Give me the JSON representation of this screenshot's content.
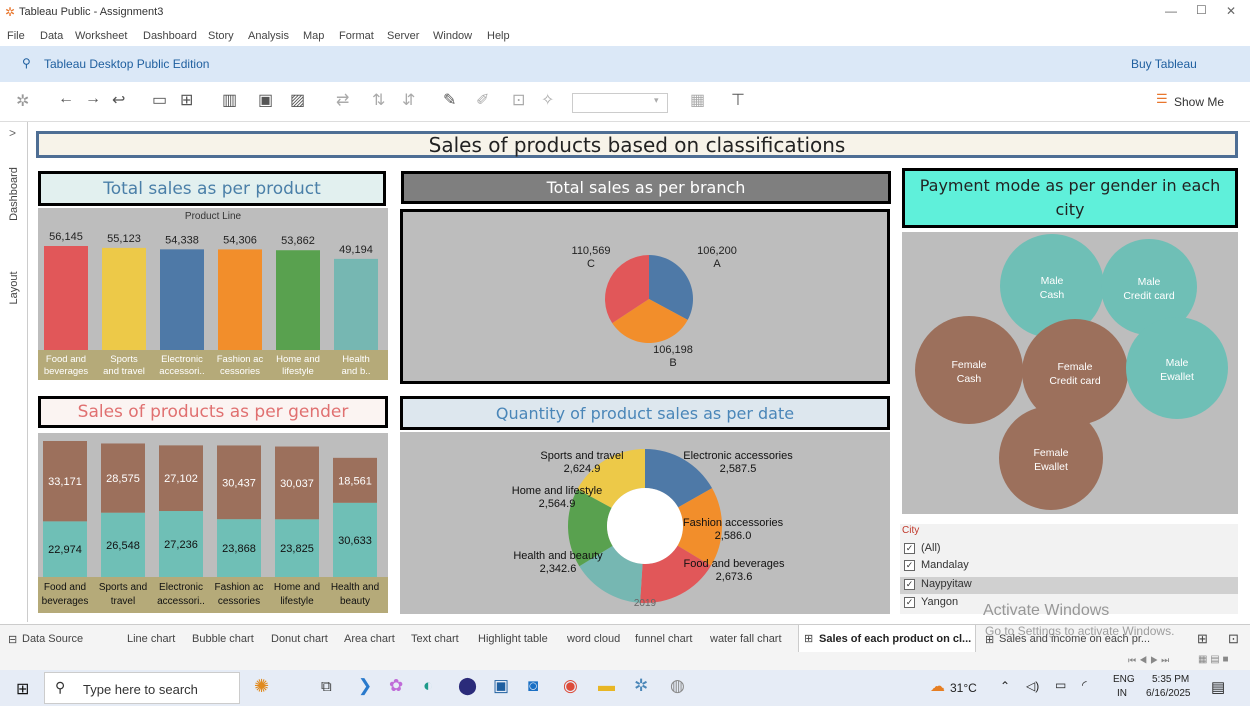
{
  "window": {
    "title": "Tableau Public - Assignment3",
    "controls": [
      "—",
      "☐",
      "✕"
    ]
  },
  "menu": [
    "File",
    "Data",
    "Worksheet",
    "Dashboard",
    "Story",
    "Analysis",
    "Map",
    "Format",
    "Server",
    "Window",
    "Help"
  ],
  "public_bar": {
    "edition": "Tableau Desktop Public Edition",
    "buy": "Buy Tableau"
  },
  "toolbar": {
    "show_me": "Show Me"
  },
  "side_tabs": {
    "expand": ">",
    "dashboard": "Dashboard",
    "layout": "Layout"
  },
  "dashboard_title": "Sales of products based on classifications",
  "product_sales": {
    "title": "Total sales as per product",
    "header": "Product Line",
    "categories": [
      "Food and beverages",
      "Sports and travel",
      "Electronic accessori..",
      "Fashion ac cessories",
      "Home and lifestyle",
      "Health and b.."
    ],
    "cat_lines": [
      [
        "Food and",
        "beverages"
      ],
      [
        "Sports",
        "and travel"
      ],
      [
        "Electronic",
        "accessori.."
      ],
      [
        "Fashion ac",
        "cessories"
      ],
      [
        "Home and",
        "lifestyle"
      ],
      [
        "Health",
        "and b.."
      ]
    ],
    "value_labels": [
      "56,145",
      "55,123",
      "54,338",
      "54,306",
      "53,862",
      "49,194"
    ],
    "colors": [
      "#e15759",
      "#edc948",
      "#4e79a7",
      "#f28e2b",
      "#59a14f",
      "#76b7b2"
    ]
  },
  "branch_sales": {
    "title": "Total sales as per branch",
    "slices": [
      {
        "branch": "A",
        "label": "106,200",
        "color": "#4e79a7"
      },
      {
        "branch": "B",
        "label": "106,198",
        "color": "#f28e2b"
      },
      {
        "branch": "C",
        "label": "110,569",
        "color": "#e15759"
      }
    ]
  },
  "payment_mode": {
    "title": "Payment mode as per gender in each city",
    "bubbles": [
      {
        "line1": "Male",
        "line2": "Cash",
        "color": "#6fbfb6"
      },
      {
        "line1": "Male",
        "line2": "Credit card",
        "color": "#6fbfb6"
      },
      {
        "line1": "Female",
        "line2": "Cash",
        "color": "#9c705c"
      },
      {
        "line1": "Female",
        "line2": "Credit card",
        "color": "#9c705c"
      },
      {
        "line1": "Male",
        "line2": "Ewallet",
        "color": "#6fbfb6"
      },
      {
        "line1": "Female",
        "line2": "Ewallet",
        "color": "#9c705c"
      }
    ]
  },
  "gender_sales": {
    "title": "Sales of products as per gender",
    "cat_lines": [
      [
        "Food and",
        "beverages"
      ],
      [
        "Sports and",
        "travel"
      ],
      [
        "Electronic",
        "accessori.."
      ],
      [
        "Fashion ac",
        "cessories"
      ],
      [
        "Home and",
        "lifestyle"
      ],
      [
        "Health and",
        "beauty"
      ]
    ],
    "top_labels": [
      "33,171",
      "28,575",
      "27,102",
      "30,437",
      "30,037",
      "18,561"
    ],
    "bottom_labels": [
      "22,974",
      "26,548",
      "27,236",
      "23,868",
      "23,825",
      "30,633"
    ],
    "colors": {
      "top": "#9c705c",
      "bottom": "#6fbfb6"
    }
  },
  "quantity_date": {
    "title": "Quantity of product sales as per date",
    "year": "2019",
    "slices": [
      {
        "name": "Electronic accessories",
        "label": "2,587.5",
        "color": "#4e79a7"
      },
      {
        "name": "Fashion accessories",
        "label": "2,586.0",
        "color": "#f28e2b"
      },
      {
        "name": "Food and beverages",
        "label": "2,673.6",
        "color": "#e15759"
      },
      {
        "name": "Health and beauty",
        "label": "2,342.6",
        "color": "#76b7b2"
      },
      {
        "name": "Home and lifestyle",
        "label": "2,564.9",
        "color": "#59a14f"
      },
      {
        "name": "Sports and travel",
        "label": "2,624.9",
        "color": "#edc948"
      }
    ]
  },
  "city_filter": {
    "title": "City",
    "items": [
      {
        "label": "(All)",
        "checked": true
      },
      {
        "label": "Mandalay",
        "checked": true
      },
      {
        "label": "Naypyitaw",
        "checked": true
      },
      {
        "label": "Yangon",
        "checked": true
      }
    ]
  },
  "watermark": {
    "line1": "Activate Windows",
    "line2": "Go to Settings to activate Windows."
  },
  "sheet_tabs": {
    "data_source": "Data Source",
    "tabs": [
      "Line chart",
      "Bubble chart",
      "Donut chart",
      "Area chart",
      "Text chart",
      "Highlight table",
      "word cloud",
      "funnel chart",
      "water fall chart",
      "Sales of each product on cl...",
      "Sales and income on each pr..."
    ]
  },
  "taskbar": {
    "search_placeholder": "Type here to search",
    "weather": "31°C",
    "lang1": "ENG",
    "lang2": "IN",
    "time": "5:35 PM",
    "date": "6/16/2025"
  }
}
